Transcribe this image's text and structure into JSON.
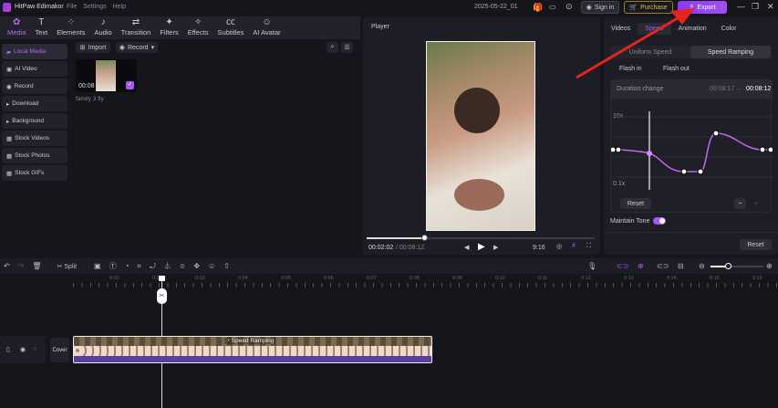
{
  "app": {
    "title": "HitPaw Edimakor",
    "menu": [
      "File",
      "Settings",
      "Help"
    ],
    "project_name": "2025-05-22_01"
  },
  "topbar": {
    "sign_in": "Sign in",
    "purchase": "Purchase",
    "export": "Export"
  },
  "toolbar_tabs": [
    {
      "label": "Media",
      "icon": "media-icon"
    },
    {
      "label": "Text",
      "icon": "text-icon"
    },
    {
      "label": "Elements",
      "icon": "elements-icon"
    },
    {
      "label": "Audio",
      "icon": "audio-icon"
    },
    {
      "label": "Transition",
      "icon": "transition-icon"
    },
    {
      "label": "Filters",
      "icon": "filters-icon"
    },
    {
      "label": "Effects",
      "icon": "effects-icon"
    },
    {
      "label": "Subtitles",
      "icon": "subtitles-icon"
    },
    {
      "label": "AI Avatar",
      "icon": "ai-avatar-icon"
    }
  ],
  "sidebar": {
    "items": [
      {
        "label": "Local Media",
        "icon": "folder-icon"
      },
      {
        "label": "AI Video",
        "icon": "ai-video-icon"
      },
      {
        "label": "Record",
        "icon": "record-icon"
      },
      {
        "label": "Download",
        "icon": "chevron-right-icon"
      },
      {
        "label": "Background",
        "icon": "chevron-right-icon"
      },
      {
        "label": "Stock Videos",
        "icon": "stock-icon"
      },
      {
        "label": "Stock Photos",
        "icon": "stock-icon"
      },
      {
        "label": "Stock GIFs",
        "icon": "stock-icon"
      }
    ]
  },
  "media": {
    "import": "Import",
    "record": "Record",
    "clip": {
      "duration": "00:08",
      "name": "family 3 fly"
    }
  },
  "player": {
    "title": "Player",
    "current": "00:02:02",
    "total": "/ 00:08:12",
    "aspect": "9:16",
    "progress": 0.25
  },
  "right_panel": {
    "tabs": [
      "Videos",
      "Speed",
      "Animation",
      "Color"
    ],
    "active_tab": "Speed",
    "modes": [
      "Uniform Speed",
      "Speed Ramping"
    ],
    "presets": [
      "Flash in",
      "Flash out"
    ],
    "duration_label": "Duration change",
    "duration_from": "00:08:17",
    "arrow": "→",
    "duration_to": "00:08:12",
    "y_max": "10x",
    "y_min": "0.1x",
    "reset": "Reset",
    "minus": "−",
    "plus": "+",
    "maintain_tone": "Maintain Tone",
    "maintain_tone_on": true,
    "reset_all": "Reset"
  },
  "timeline": {
    "split": "Split",
    "ticks": [
      "0:01",
      "0:02",
      "0:03",
      "0:04",
      "0:05",
      "0:06",
      "0:07",
      "0:08",
      "0:09",
      "0:10",
      "0:11",
      "0:12",
      "0:13",
      "0:14",
      "0:15",
      "0:16"
    ],
    "cover": "Cover",
    "clip_label": "Speed Ramping"
  },
  "colors": {
    "accent": "#a855f7",
    "export": "#9b3ef0",
    "annotation_arrow": "#e5241f",
    "clip_audio": "#5b3fa0"
  }
}
